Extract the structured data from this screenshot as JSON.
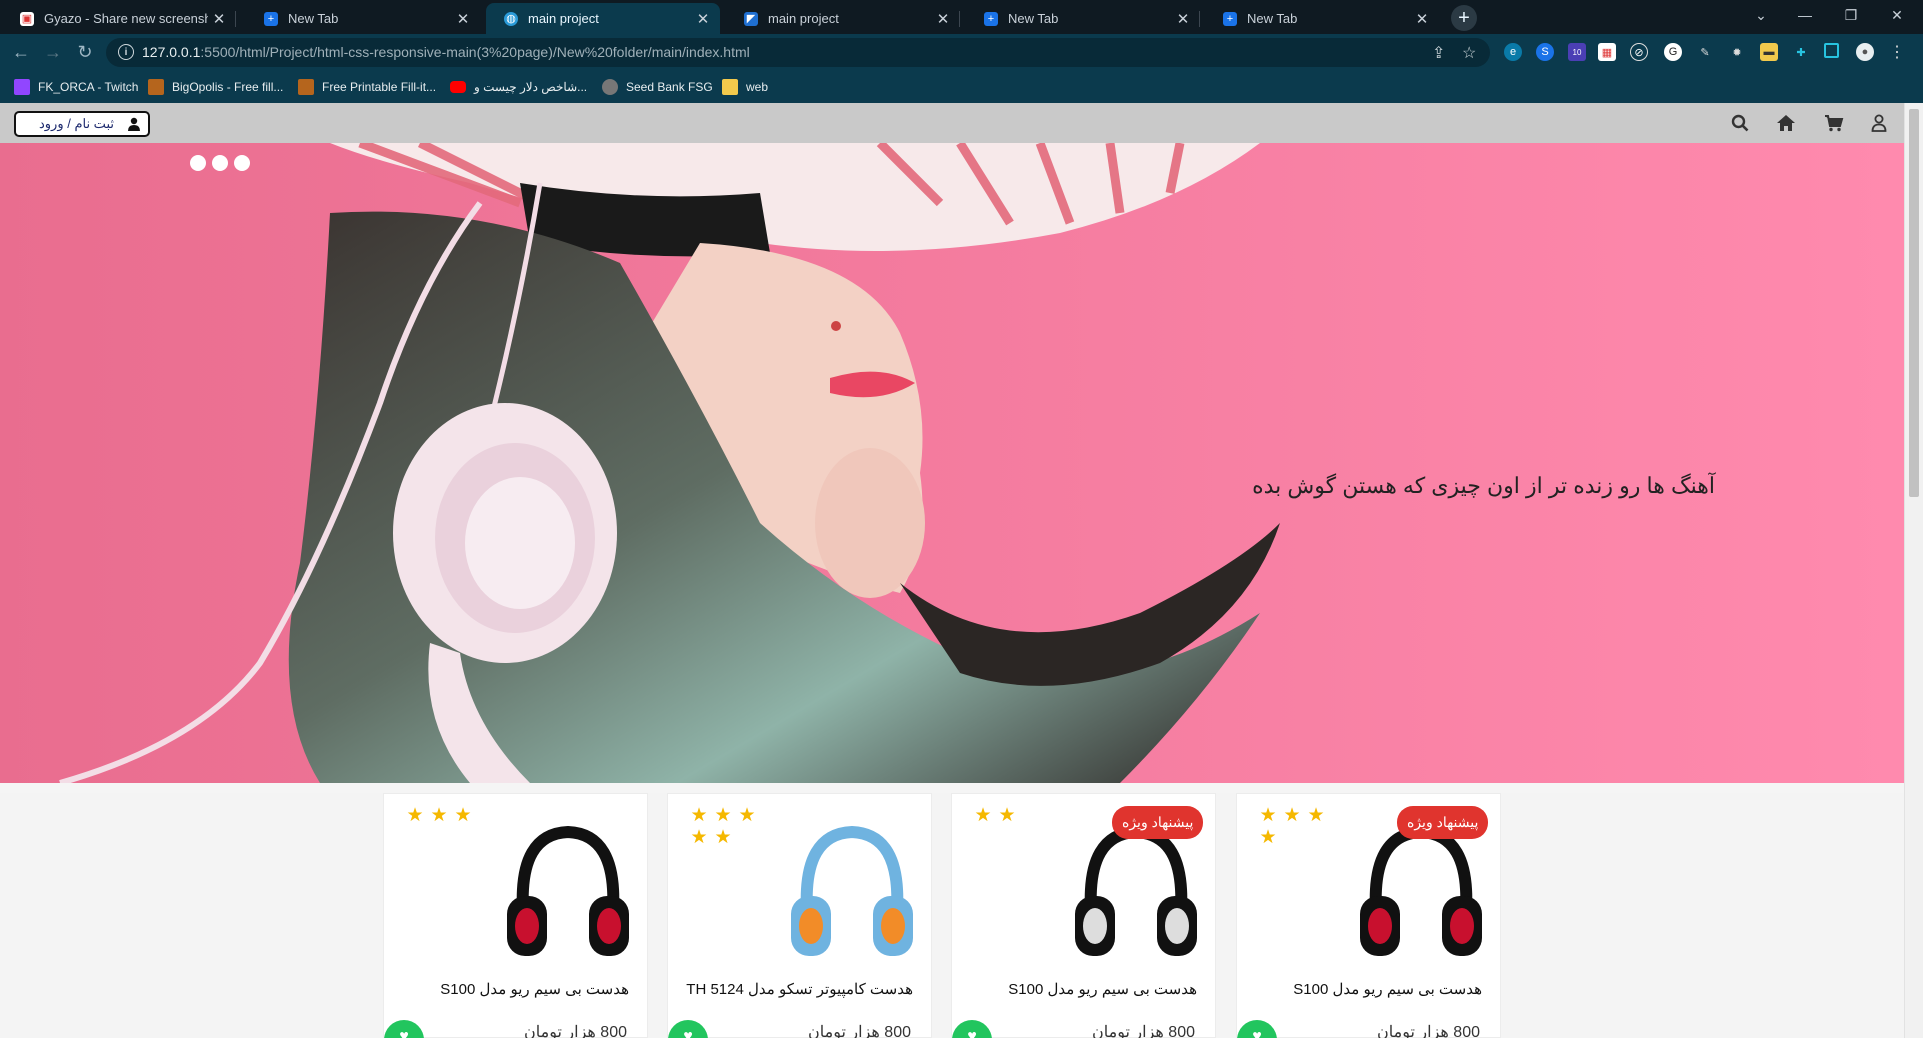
{
  "browser": {
    "tabs": [
      {
        "title": "Gyazo - Share new screenshots.",
        "favicon": "gyazo-icon",
        "active": false
      },
      {
        "title": "New Tab",
        "favicon": "new-tab-icon",
        "active": false
      },
      {
        "title": "main project",
        "favicon": "globe-icon",
        "active": true
      },
      {
        "title": "main project",
        "favicon": "vscode-icon",
        "active": false
      },
      {
        "title": "New Tab",
        "favicon": "new-tab-icon",
        "active": false
      },
      {
        "title": "New Tab",
        "favicon": "new-tab-icon",
        "active": false
      }
    ],
    "url_host": "127.0.0.1",
    "url_rest": ":5500/html/Project/html-css-responsive-main(3%20page)/New%20folder/main/index.html",
    "extension_badge": "10",
    "bookmarks": [
      {
        "label": "FK_ORCA - Twitch",
        "icon": "twitch-icon",
        "color": "#9146ff"
      },
      {
        "label": "BigOpolis - Free fill...",
        "icon": "bigopolis-icon",
        "color": "#b5651d"
      },
      {
        "label": "Free Printable Fill-it...",
        "icon": "printable-icon",
        "color": "#b5651d"
      },
      {
        "label": "شاخص دلار چیست و...",
        "icon": "youtube-icon",
        "color": "#ff0000"
      },
      {
        "label": "Seed Bank FSG",
        "icon": "globe-icon",
        "color": "#777777"
      },
      {
        "label": "web",
        "icon": "folder-icon",
        "color": "#f2c94c"
      }
    ]
  },
  "site": {
    "login_label": "ثبت نام / ورود",
    "hero_text": "آهنگ ها رو زنده تر از اون چیزی که هستن گوش بده",
    "products": [
      {
        "name": "هدست بی سیم ریو مدل S100",
        "price": "800 هزار تومان",
        "stars": 4,
        "badge": "پیشنهاد ویژه"
      },
      {
        "name": "هدست بی سیم ریو مدل S100",
        "price": "800 هزار تومان",
        "stars": 2,
        "badge": "پیشنهاد ویژه"
      },
      {
        "name": "هدست کامپیوتر تسکو مدل TH 5124",
        "price": "800 هزار تومان",
        "stars": 5,
        "badge": ""
      },
      {
        "name": "هدست بی سیم ریو مدل S100",
        "price": "800 هزار تومان",
        "stars": 3,
        "badge": ""
      }
    ]
  },
  "colors": {
    "tab_strip": "#0f1a22",
    "toolbar": "#0b3a4d",
    "hero_bg": "#f68aa6",
    "badge": "#e0342e",
    "star": "#f5b800",
    "fav_button": "#22c55e"
  }
}
